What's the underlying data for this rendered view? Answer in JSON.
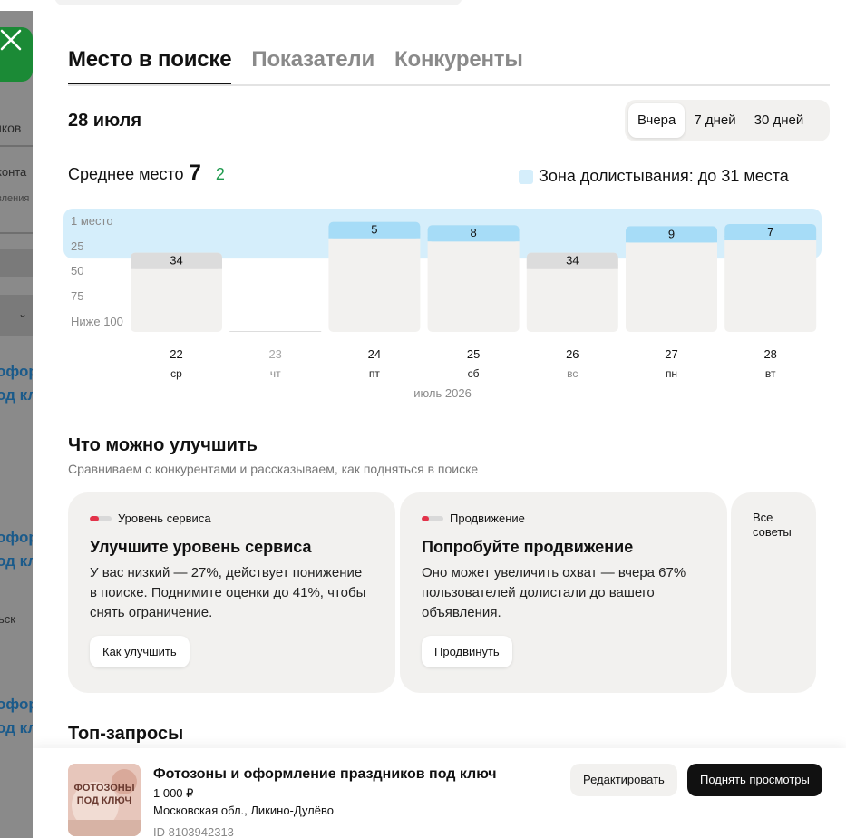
{
  "background": {
    "fragments": [
      "иков",
      "конта",
      "вления",
      "ьск"
    ],
    "links": [
      "офор",
      "од кл",
      "офор",
      "од кл",
      "офор",
      "од кл"
    ]
  },
  "tabs": [
    {
      "label": "Место в поиске",
      "active": true
    },
    {
      "label": "Показатели",
      "active": false
    },
    {
      "label": "Конкуренты",
      "active": false
    }
  ],
  "date": "28 июля",
  "period": {
    "options": [
      "Вчера",
      "7 дней",
      "30 дней"
    ],
    "selected": "Вчера"
  },
  "average": {
    "label": "Среднее место",
    "value": "7",
    "delta": "2"
  },
  "zone_legend": "Зона долистывания: до 31 места",
  "colors": {
    "zone": "#d5eefb",
    "bar_in_zone": "#a6dcf7",
    "bar_out_zone": "#dcdcdc",
    "bar_body": "#f2f1ef",
    "delta_green": "#1f9a4e",
    "accent_red": "#e3334a"
  },
  "chart_data": {
    "type": "bar",
    "y_ticks": [
      "1 место",
      "25",
      "50",
      "75",
      "Ниже 100"
    ],
    "zone_max_place": 31,
    "categories": [
      "22",
      "23",
      "24",
      "25",
      "26",
      "27",
      "28"
    ],
    "weekdays": [
      "ср",
      "чт",
      "пт",
      "сб",
      "вс",
      "пн",
      "вт"
    ],
    "values": [
      34,
      null,
      5,
      8,
      34,
      9,
      7
    ],
    "value_labels": [
      "34",
      "",
      "5",
      "8",
      "34",
      "9",
      "7"
    ],
    "xlabel": "июль 2026"
  },
  "improve": {
    "title": "Что можно улучшить",
    "subtitle": "Сравниваем с конкурентами и рассказываем, как подняться в поиске",
    "cards": [
      {
        "tag": "Уровень сервиса",
        "tag_level": 0.4,
        "title": "Улучшите уровень сервиса",
        "text": "У вас низкий — 27%, действует понижение в поиске. Поднимите оценки до 41%, чтобы снять ограничение.",
        "button": "Как улучшить"
      },
      {
        "tag": "Продвижение",
        "tag_level": 0.33,
        "title": "Попробуйте продвижение",
        "text": "Оно может увеличить охват — вчера 67% пользователей долистали до вашего объявления.",
        "button": "Продвинуть"
      }
    ],
    "all_tips": "Все советы"
  },
  "top_queries": {
    "title": "Топ-запросы"
  },
  "ad": {
    "title": "Фотозоны и оформление праздников под ключ",
    "price": "1 000 ₽",
    "location": "Московская обл., Ликино-Дулёво",
    "id": "ID 8103942313",
    "thumb_text": [
      "ФОТОЗОНЫ",
      "ПОД КЛЮЧ"
    ],
    "edit_button": "Редактировать",
    "boost_button": "Поднять просмотры"
  }
}
